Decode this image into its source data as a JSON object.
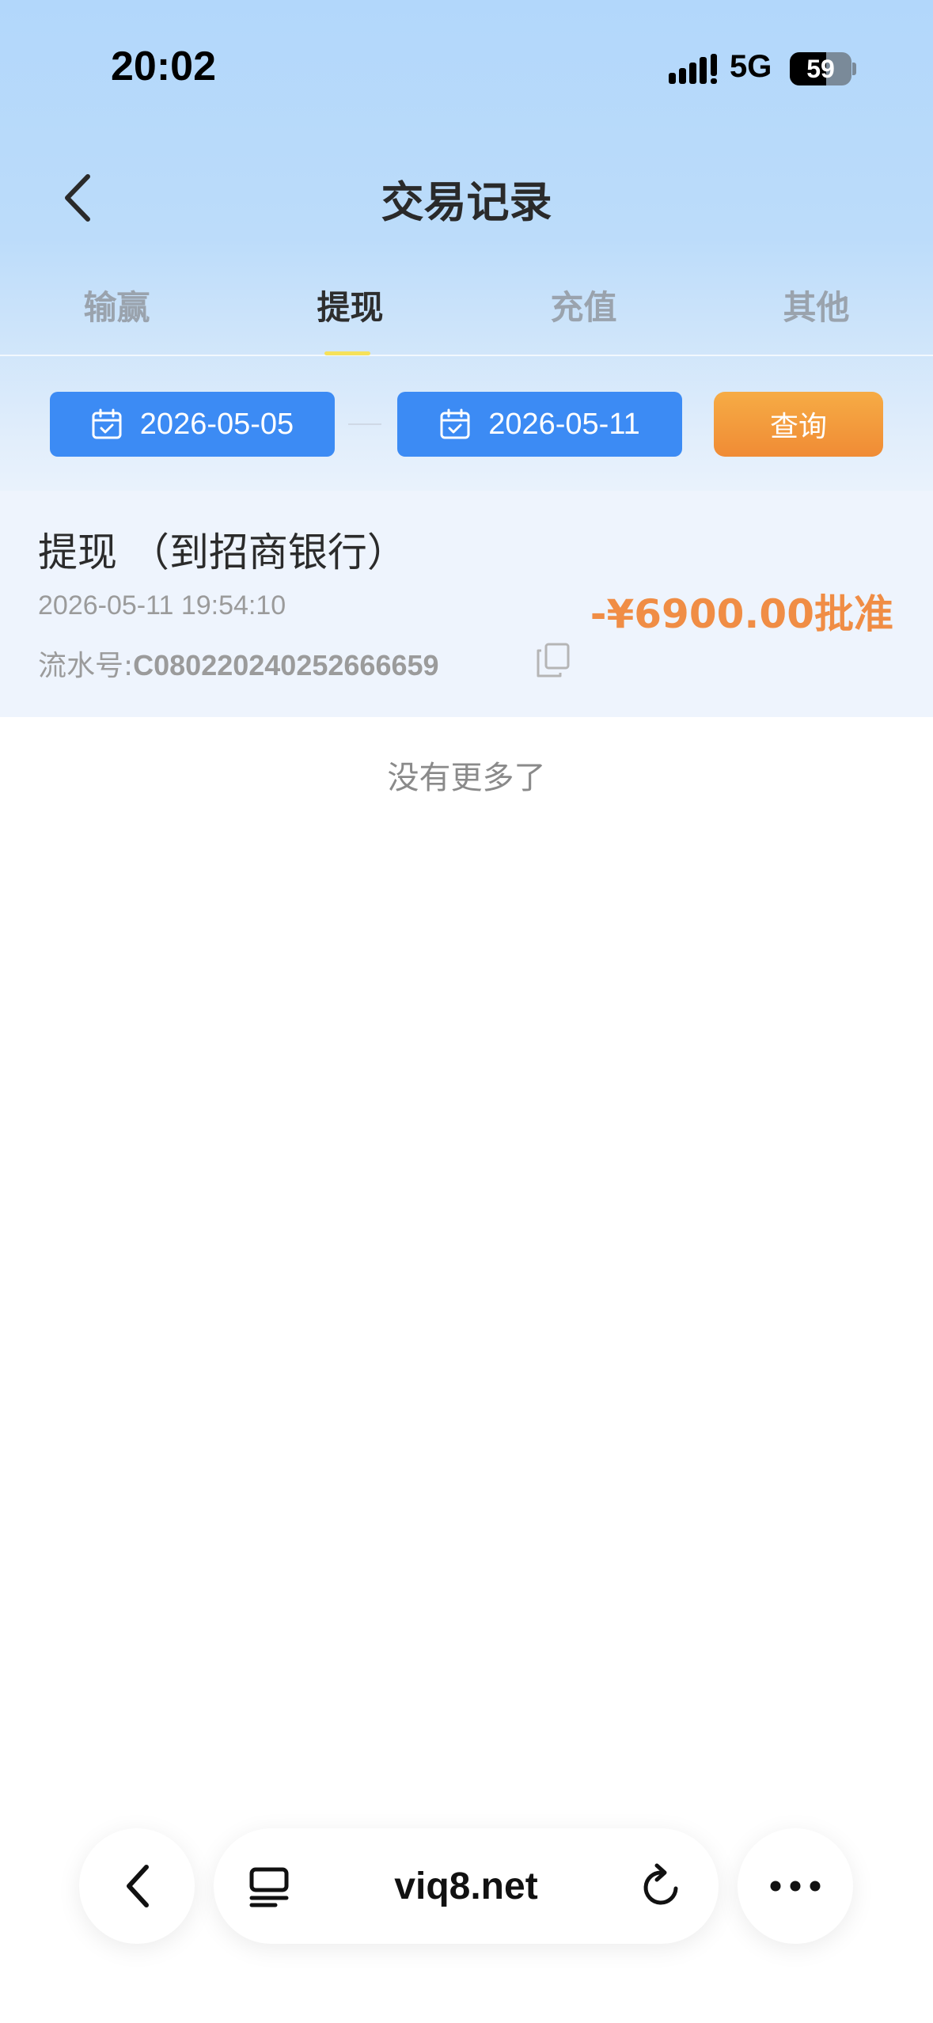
{
  "status_bar": {
    "time": "20:02",
    "network": "5G",
    "battery": "59",
    "battery_level": 0.59
  },
  "nav": {
    "title": "交易记录"
  },
  "tabs": [
    {
      "label": "输赢",
      "active": false
    },
    {
      "label": "提现",
      "active": true
    },
    {
      "label": "充值",
      "active": false
    },
    {
      "label": "其他",
      "active": false
    }
  ],
  "filter": {
    "start_date": "2026-05-05",
    "end_date": "2026-05-11",
    "query_label": "查询"
  },
  "records": [
    {
      "title": "提现 （到招商银行）",
      "time": "2026-05-11 19:54:10",
      "serial_label": "流水号:",
      "serial_number": "C080220240252666659",
      "amount": "-¥6900.00批准"
    }
  ],
  "list_end_text": "没有更多了",
  "browser": {
    "url": "viq8.net"
  },
  "colors": {
    "primary_blue": "#3c8bf4",
    "accent_orange": "#f08d45",
    "tab_indicator": "#f6e15a"
  }
}
